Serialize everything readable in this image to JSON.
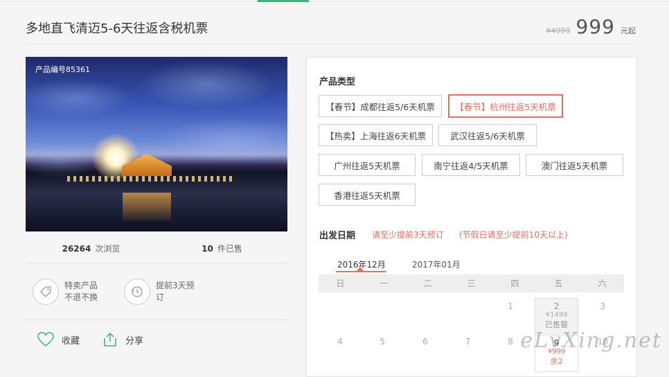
{
  "product": {
    "title": "多地直飞清迈5-6天往返含税机票",
    "old_price": "¥4999",
    "price": "999",
    "price_unit": "元起",
    "code": "产品编号85361"
  },
  "stats": {
    "views": "26264",
    "views_label": "次浏览",
    "sold": "10",
    "sold_label": "件已售"
  },
  "features": [
    {
      "text": "特卖产品不退不换",
      "icon": "tag-icon"
    },
    {
      "text": "提前3天预订",
      "icon": "history-clock-icon"
    }
  ],
  "actions": {
    "favorite": "收藏",
    "share": "分享"
  },
  "product_type": {
    "label": "产品类型",
    "options": [
      "【春节】成都往返5/6天机票",
      "【春节】杭州往返5天机票",
      "【热卖】上海往返6天机票",
      "武汉往返5/6天机票",
      "广州往返5天机票",
      "南宁往返4/5天机票",
      "澳门往返5天机票",
      "香港往返5天机票"
    ],
    "selected_index": 1
  },
  "departure": {
    "label": "出发日期",
    "notice1": "请至少提前3天预订",
    "notice2": "(节假日请至少提前10天以上)",
    "months": [
      "2016年12月",
      "2017年01月"
    ],
    "weekdays": [
      "日",
      "一",
      "二",
      "三",
      "四",
      "五",
      "六"
    ],
    "row1": [
      "",
      "",
      "",
      "",
      "1",
      "2",
      "3"
    ],
    "row2": [
      "4",
      "5",
      "6",
      "7",
      "8",
      "9",
      "10"
    ],
    "cell_dec2": {
      "price": "¥1499",
      "status": "已售罄"
    },
    "cell_dec9": {
      "price": "¥999",
      "status": "余2"
    }
  },
  "watermark": "eLvXing.net",
  "colors": {
    "accent": "#e56b5e",
    "green": "#3ab37a"
  }
}
